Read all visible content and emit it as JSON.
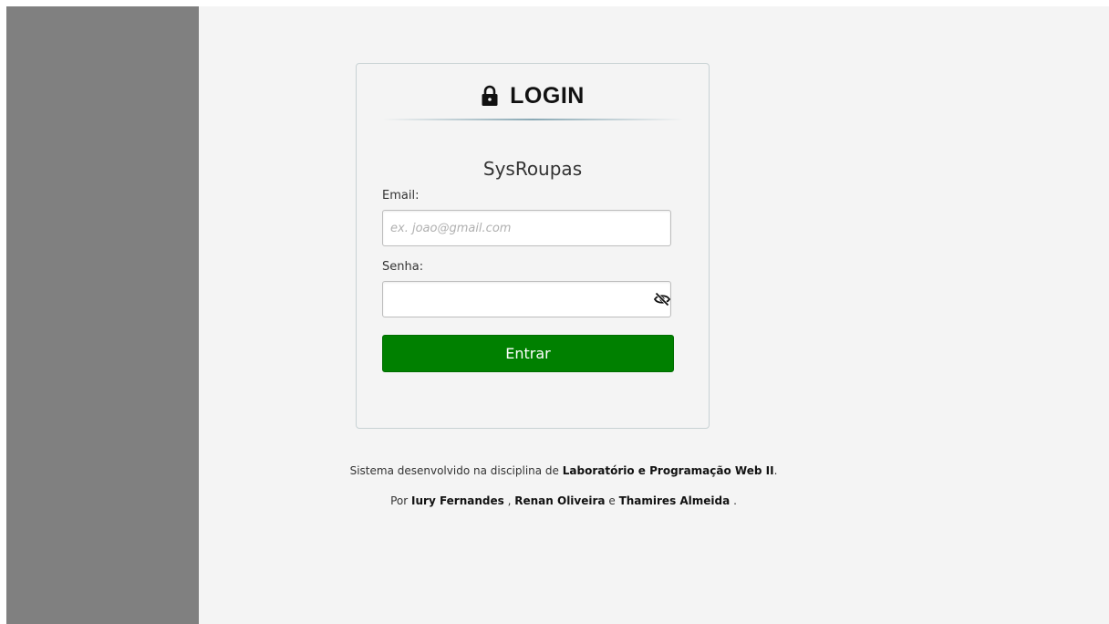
{
  "login": {
    "title": "LOGIN",
    "app_name": "SysRoupas",
    "email_label": "Email:",
    "email_placeholder": "ex. joao@gmail.com",
    "email_value": "",
    "senha_label": "Senha:",
    "senha_value": "",
    "enter_label": "Entrar",
    "lock_icon": "lock-icon",
    "eye_icon": "eye-slash-icon"
  },
  "footer": {
    "line1_prefix": "Sistema desenvolvido na disciplina de",
    "discipline": "Laboratório e Programação Web II",
    "line1_suffix": ".",
    "line2_prefix": "Por",
    "author1": "Iury Fernandes",
    "sep1": ",",
    "author2": "Renan Oliveira",
    "sep2": "e",
    "author3": "Thamires Almeida",
    "line2_suffix": "."
  },
  "colors": {
    "sidebar": "#808080",
    "background": "#f4f4f4",
    "button": "#008000"
  }
}
